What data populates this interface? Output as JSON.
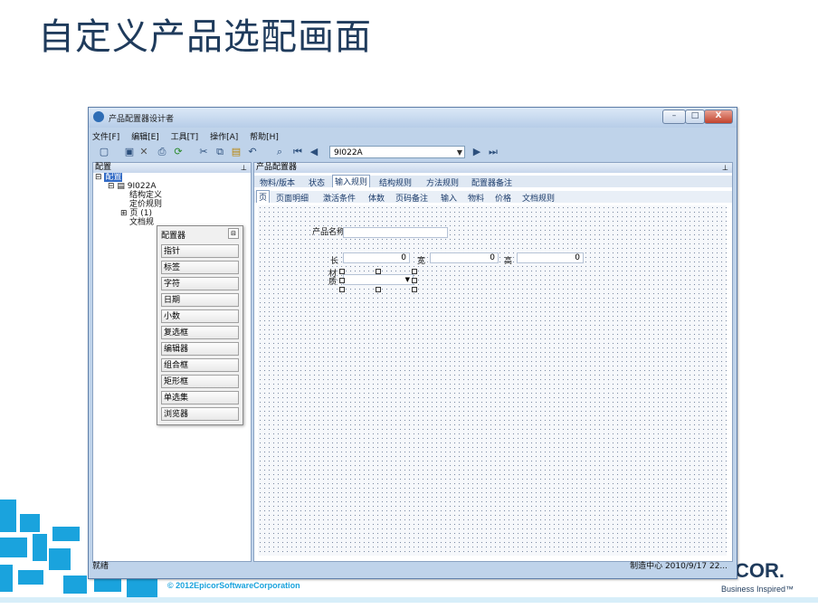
{
  "slide": {
    "title": "自定义产品选配画面",
    "copyright": "© 2012EpicorSoftwareCorporation",
    "logo_text": "COR.",
    "logo_tagline": "Business Inspired™"
  },
  "window": {
    "title": "产品配置器设计者",
    "buttons": {
      "minimize": "–",
      "maximize": "□",
      "close": "X"
    }
  },
  "menu": [
    "文件[F]",
    "编辑[E]",
    "工具[T]",
    "操作[A]",
    "帮助[H]"
  ],
  "toolbar": {
    "part_combo_value": "9I022A"
  },
  "left_pane": {
    "header": "配置",
    "tree": {
      "root": "配置",
      "part": "9I022A",
      "structure_def": "结构定义",
      "pricing_rules": "定价规则",
      "pages": "页 (1)",
      "doc_rules": "文档规"
    }
  },
  "toolbox": {
    "title": "配置器",
    "items": [
      "指针",
      "标签",
      "字符",
      "日期",
      "小数",
      "复选框",
      "编辑器",
      "组合框",
      "矩形框",
      "单选集",
      "浏览器"
    ]
  },
  "right_pane": {
    "header": "产品配置器",
    "tabs_top": [
      "物料/版本",
      "状态",
      "输入规则",
      "结构规则",
      "方法规则",
      "配置器备注"
    ],
    "tabs_bottom": [
      "页",
      "页面明细",
      "激活条件",
      "体数",
      "页码备注",
      "输入",
      "物料",
      "价格",
      "文档规则"
    ],
    "form": {
      "product_name_label": "产品名称",
      "length_label": "长",
      "length_value": "0",
      "width_label": "宽",
      "width_value": "0",
      "height_label": "高",
      "height_value": "0",
      "material_label": "材质"
    }
  },
  "status": {
    "left": "就绪",
    "right": "制造中心   2010/9/17   22..."
  },
  "colors": {
    "accent": "#1aa3dd",
    "title": "#1f3b5c",
    "selection": "#316ac5"
  }
}
